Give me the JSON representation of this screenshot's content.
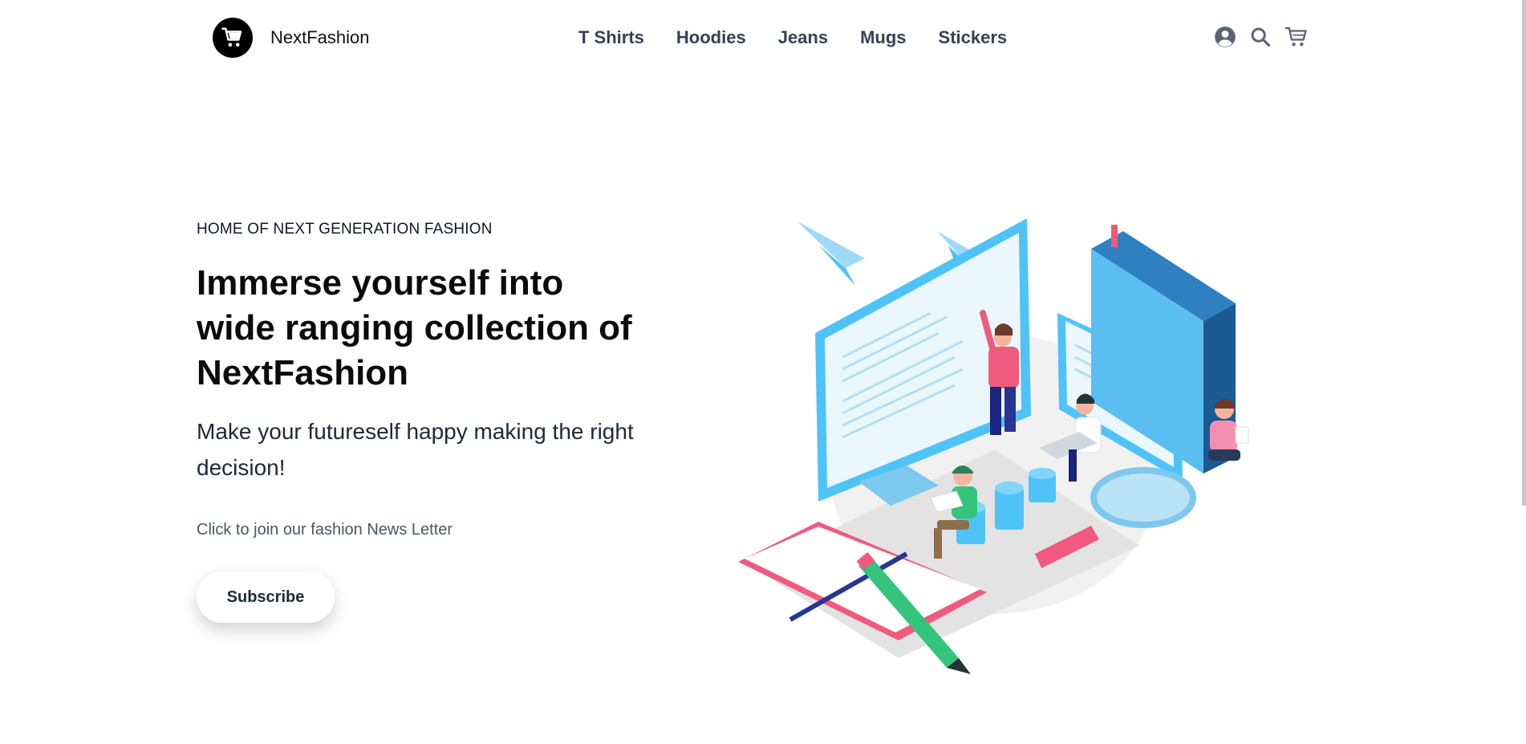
{
  "brand": {
    "name": "NextFashion",
    "logo_icon": "cart-icon"
  },
  "nav": {
    "items": [
      {
        "label": "T Shirts"
      },
      {
        "label": "Hoodies"
      },
      {
        "label": "Jeans"
      },
      {
        "label": "Mugs"
      },
      {
        "label": "Stickers"
      }
    ]
  },
  "header_icons": [
    "user-circle-icon",
    "search-icon",
    "cart-icon"
  ],
  "hero": {
    "eyebrow": "HOME OF NEXT GENERATION FASHION",
    "headline_lines": [
      "Immerse yourself into",
      "wide ranging collection of",
      "NextFashion"
    ],
    "subheading": "Make your futureself happy making the right decision!",
    "newsletter_text": "Click to join our fashion News Letter",
    "subscribe_label": "Subscribe"
  },
  "illustration": {
    "name": "isometric-learning-illustration"
  },
  "colors": {
    "accent_blue": "#4fc3f7",
    "accent_pink": "#f05a7e",
    "accent_green": "#34c47c",
    "nav_text": "#374151"
  }
}
